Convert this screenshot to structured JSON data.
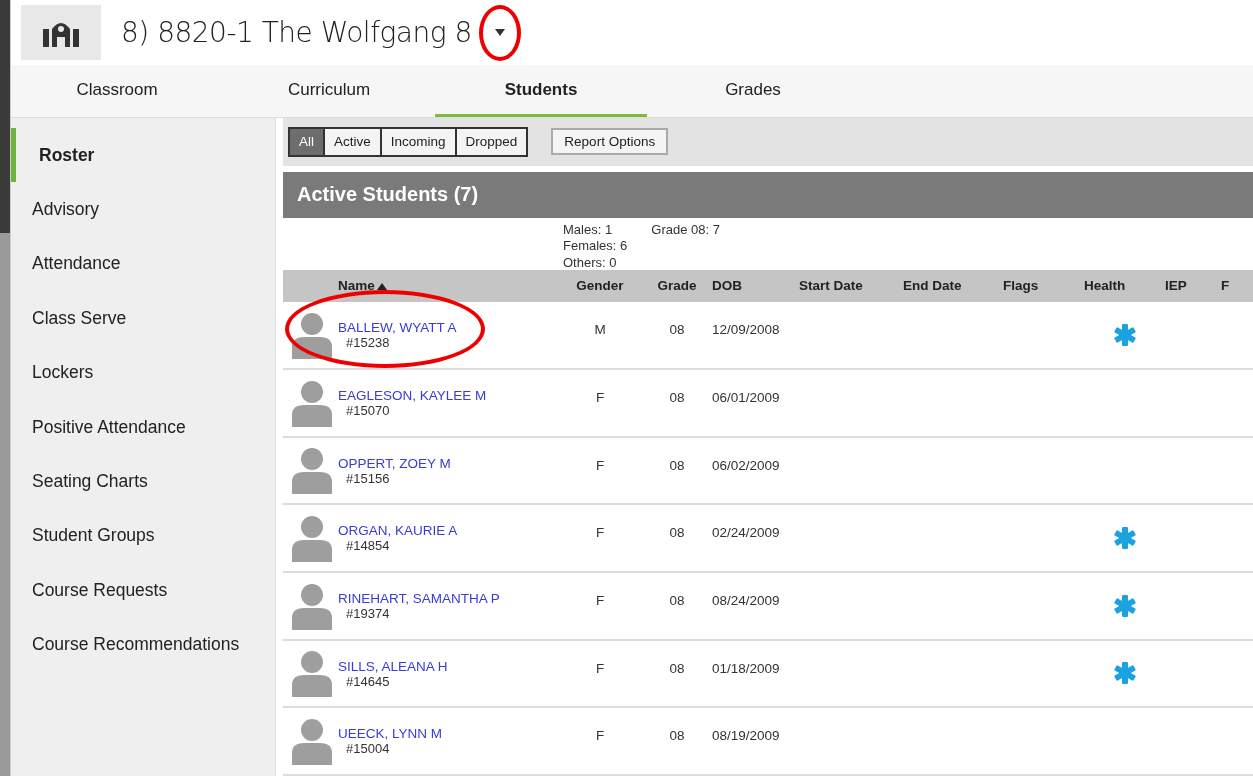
{
  "header": {
    "title": "8) 8820-1 The Wolfgang 8"
  },
  "tabs": [
    {
      "label": "Classroom",
      "selected": false
    },
    {
      "label": "Curriculum",
      "selected": false
    },
    {
      "label": "Students",
      "selected": true
    },
    {
      "label": "Grades",
      "selected": false
    }
  ],
  "sidebar": {
    "items": [
      {
        "label": "Roster",
        "selected": true
      },
      {
        "label": "Advisory",
        "selected": false
      },
      {
        "label": "Attendance",
        "selected": false
      },
      {
        "label": "Class Serve",
        "selected": false
      },
      {
        "label": "Lockers",
        "selected": false
      },
      {
        "label": "Positive Attendance",
        "selected": false
      },
      {
        "label": "Seating Charts",
        "selected": false
      },
      {
        "label": "Student Groups",
        "selected": false
      },
      {
        "label": "Course Requests",
        "selected": false
      },
      {
        "label": "Course Recommendations",
        "selected": false
      }
    ]
  },
  "filters": [
    {
      "label": "All",
      "selected": true
    },
    {
      "label": "Active",
      "selected": false
    },
    {
      "label": "Incoming",
      "selected": false
    },
    {
      "label": "Dropped",
      "selected": false
    }
  ],
  "report_button": "Report Options",
  "section_title": "Active Students (7)",
  "summary": {
    "gender": [
      "Males: 1",
      "Females: 6",
      "Others: 0"
    ],
    "grade": [
      "Grade 08: 7"
    ]
  },
  "table": {
    "columns": [
      "Name",
      "Gender",
      "Grade",
      "DOB",
      "Start Date",
      "End Date",
      "Flags",
      "Health",
      "IEP",
      "F"
    ],
    "rows": [
      {
        "name": "BALLEW, WYATT A",
        "id": "#15238",
        "gender": "M",
        "grade": "08",
        "dob": "12/09/2008",
        "health": true,
        "circled": true
      },
      {
        "name": "EAGLESON, KAYLEE M",
        "id": "#15070",
        "gender": "F",
        "grade": "08",
        "dob": "06/01/2009",
        "health": false,
        "circled": false
      },
      {
        "name": "OPPERT, ZOEY M",
        "id": "#15156",
        "gender": "F",
        "grade": "08",
        "dob": "06/02/2009",
        "health": false,
        "circled": false
      },
      {
        "name": "ORGAN, KAURIE A",
        "id": "#14854",
        "gender": "F",
        "grade": "08",
        "dob": "02/24/2009",
        "health": true,
        "circled": false
      },
      {
        "name": "RINEHART, SAMANTHA P",
        "id": "#19374",
        "gender": "F",
        "grade": "08",
        "dob": "08/24/2009",
        "health": true,
        "circled": false
      },
      {
        "name": "SILLS, ALEANA H",
        "id": "#14645",
        "gender": "F",
        "grade": "08",
        "dob": "01/18/2009",
        "health": true,
        "circled": false
      },
      {
        "name": "UEECK, LYNN M",
        "id": "#15004",
        "gender": "F",
        "grade": "08",
        "dob": "08/19/2009",
        "health": false,
        "circled": false
      }
    ]
  }
}
